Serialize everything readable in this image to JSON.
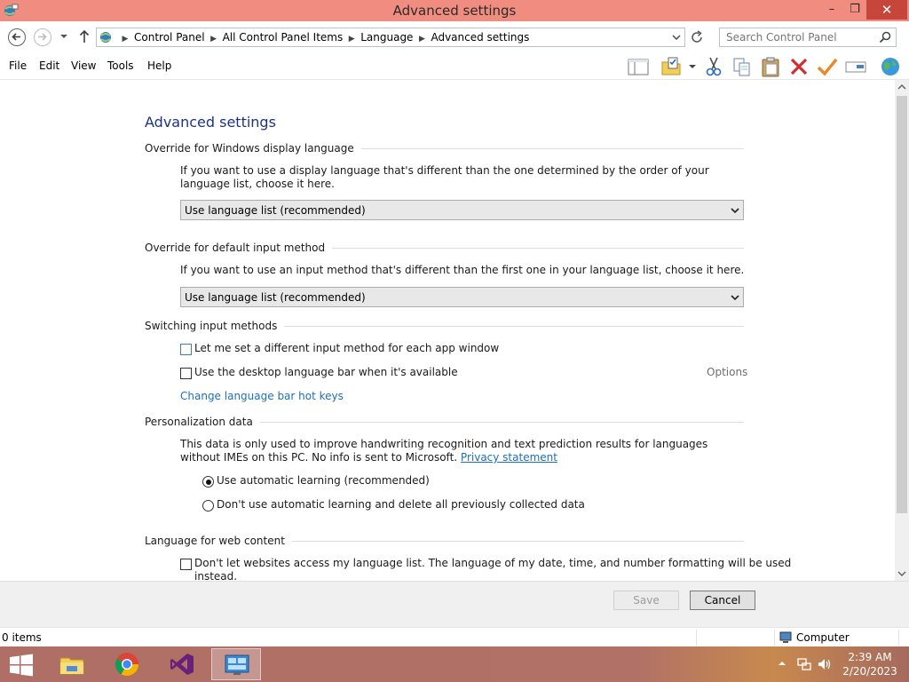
{
  "window": {
    "title": "Advanced settings",
    "minimize_glyph": "–",
    "maximize_glyph": "❐",
    "close_glyph": "✕"
  },
  "address": {
    "breadcrumbs": [
      "Control Panel",
      "All Control Panel Items",
      "Language",
      "Advanced settings"
    ],
    "separator": "▶"
  },
  "search": {
    "placeholder": "Search Control Panel"
  },
  "menu": {
    "file": "File",
    "edit": "Edit",
    "view": "View",
    "tools": "Tools",
    "help": "Help"
  },
  "toolbar_icons": [
    "layout-pane-icon",
    "folder-properties-icon",
    "dropdown-arrow-icon",
    "cut-icon",
    "copy-icon",
    "paste-icon",
    "delete-icon",
    "checkmark-icon",
    "rename-icon",
    "globe-icon"
  ],
  "page": {
    "heading": "Advanced settings",
    "display_language": {
      "title": "Override for Windows display language",
      "description": "If you want to use a display language that's different than the one determined by the order of your language list, choose it here.",
      "selected": "Use language list (recommended)"
    },
    "input_method": {
      "title": "Override for default input method",
      "description": "If you want to use an input method that's different than the first one in your language list, choose it here.",
      "selected": "Use language list (recommended)"
    },
    "switching": {
      "title": "Switching input methods",
      "per_app_label": "Let me set a different input method for each app window",
      "per_app_checked": false,
      "language_bar_label": "Use the desktop language bar when it's available",
      "language_bar_checked": false,
      "options_label": "Options",
      "hotkeys_link": "Change language bar hot keys"
    },
    "personalization": {
      "title": "Personalization data",
      "description": "This data is only used to improve handwriting recognition and text prediction results for languages without IMEs on this PC. No info is sent to Microsoft.",
      "privacy_link": "Privacy statement",
      "option_auto": "Use automatic learning (recommended)",
      "option_auto_selected": true,
      "option_no_auto": "Don't use automatic learning and delete all previously collected data",
      "option_no_auto_selected": false
    },
    "web_content": {
      "title": "Language for web content",
      "label_line1": "Don't let websites access my language list. The language of my date, time, and number formatting will be used",
      "label_line2": "instead.",
      "checked": false
    }
  },
  "buttons": {
    "save": "Save",
    "save_enabled": false,
    "cancel": "Cancel"
  },
  "status": {
    "items": "0 items",
    "zone": "Computer"
  },
  "taskbar": {
    "apps": [
      "file-explorer-icon",
      "chrome-icon",
      "visual-studio-icon",
      "control-panel-icon"
    ],
    "active_app": "control-panel-icon",
    "time": "2:39 AM",
    "date": "2/20/2023"
  },
  "colors": {
    "titlebar": "#f18d80",
    "close_button": "#c7463b",
    "heading": "#1e3287",
    "link": "#1d6fb8",
    "taskbar": "#b06f66"
  }
}
